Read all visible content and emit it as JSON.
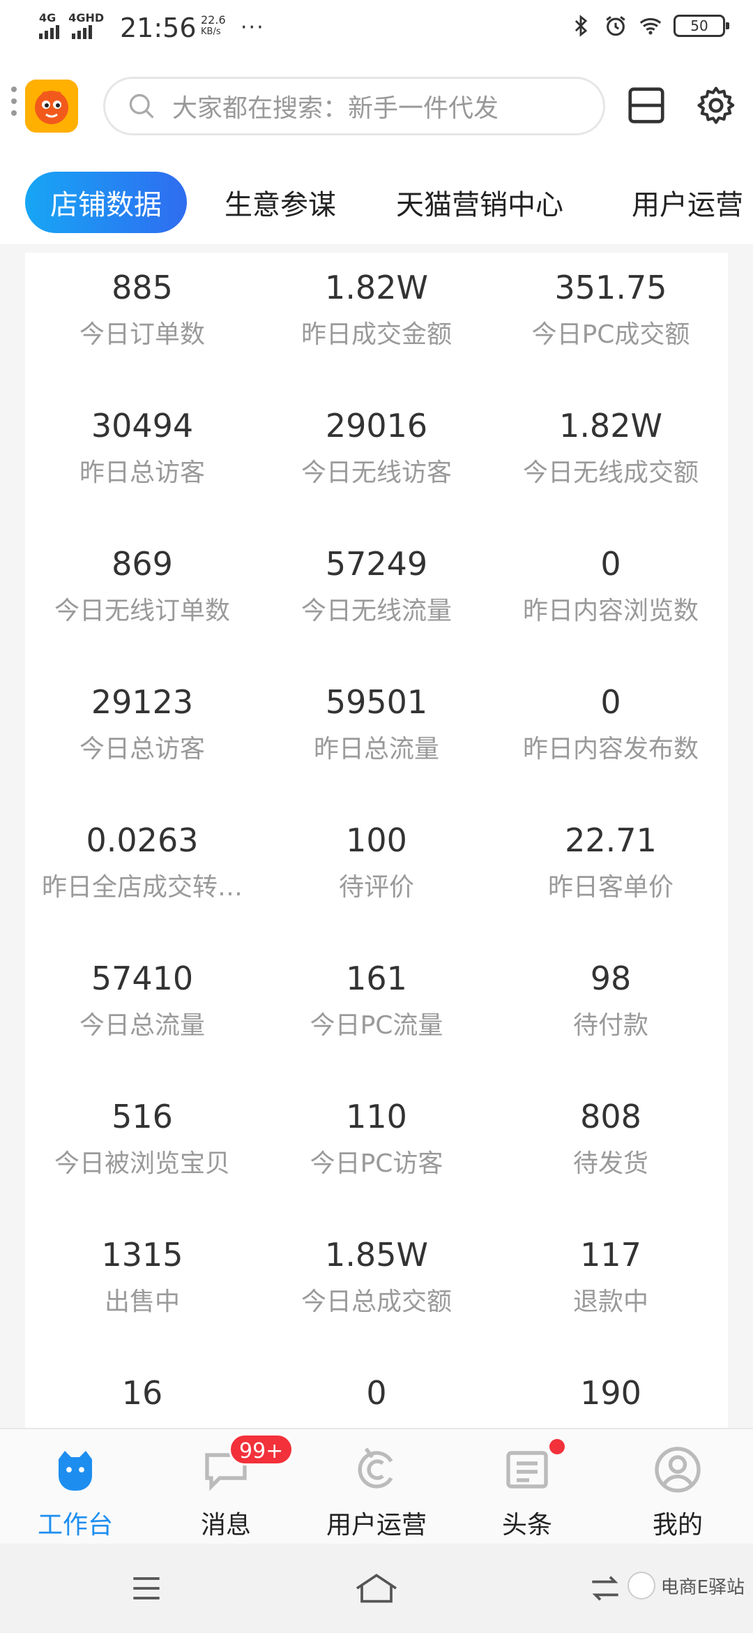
{
  "status_bar": {
    "network1": "4G",
    "network2": "4GHD",
    "time": "21:56",
    "speed_value": "22.6",
    "speed_unit": "KB/s",
    "more": "···",
    "battery": "50"
  },
  "search": {
    "placeholder": "大家都在搜索：新手一件代发"
  },
  "tabs": [
    {
      "label": "店铺数据",
      "active": true
    },
    {
      "label": "生意参谋"
    },
    {
      "label": "天猫营销中心"
    },
    {
      "label": "用户运营"
    }
  ],
  "metrics": [
    {
      "value": "885",
      "label": "今日订单数"
    },
    {
      "value": "1.82W",
      "label": "昨日成交金额"
    },
    {
      "value": "351.75",
      "label": "今日PC成交额"
    },
    {
      "value": "30494",
      "label": "昨日总访客"
    },
    {
      "value": "29016",
      "label": "今日无线访客"
    },
    {
      "value": "1.82W",
      "label": "今日无线成交额"
    },
    {
      "value": "869",
      "label": "今日无线订单数"
    },
    {
      "value": "57249",
      "label": "今日无线流量"
    },
    {
      "value": "0",
      "label": "昨日内容浏览数"
    },
    {
      "value": "29123",
      "label": "今日总访客"
    },
    {
      "value": "59501",
      "label": "昨日总流量"
    },
    {
      "value": "0",
      "label": "昨日内容发布数"
    },
    {
      "value": "0.0263",
      "label": "昨日全店成交转…"
    },
    {
      "value": "100",
      "label": "待评价"
    },
    {
      "value": "22.71",
      "label": "昨日客单价"
    },
    {
      "value": "57410",
      "label": "今日总流量"
    },
    {
      "value": "161",
      "label": "今日PC流量"
    },
    {
      "value": "98",
      "label": "待付款"
    },
    {
      "value": "516",
      "label": "今日被浏览宝贝"
    },
    {
      "value": "110",
      "label": "今日PC访客"
    },
    {
      "value": "808",
      "label": "待发货"
    },
    {
      "value": "1315",
      "label": "出售中"
    },
    {
      "value": "1.85W",
      "label": "今日总成交额"
    },
    {
      "value": "117",
      "label": "退款中"
    },
    {
      "value": "16",
      "label": ""
    },
    {
      "value": "0",
      "label": ""
    },
    {
      "value": "190",
      "label": ""
    }
  ],
  "bottom_nav": [
    {
      "label": "工作台",
      "icon": "workbench-icon",
      "active": true
    },
    {
      "label": "消息",
      "icon": "message-icon",
      "badge": "99+"
    },
    {
      "label": "用户运营",
      "icon": "user-ops-icon"
    },
    {
      "label": "头条",
      "icon": "headlines-icon",
      "dot": true
    },
    {
      "label": "我的",
      "icon": "profile-icon"
    }
  ],
  "watermark": "电商E驿站",
  "colors": {
    "accent": "#1d8ef0",
    "tab_gradient_start": "#17a6f5",
    "tab_gradient_end": "#2f6cf0",
    "badge": "#f2313a",
    "brand_orange": "#ff9a00"
  }
}
